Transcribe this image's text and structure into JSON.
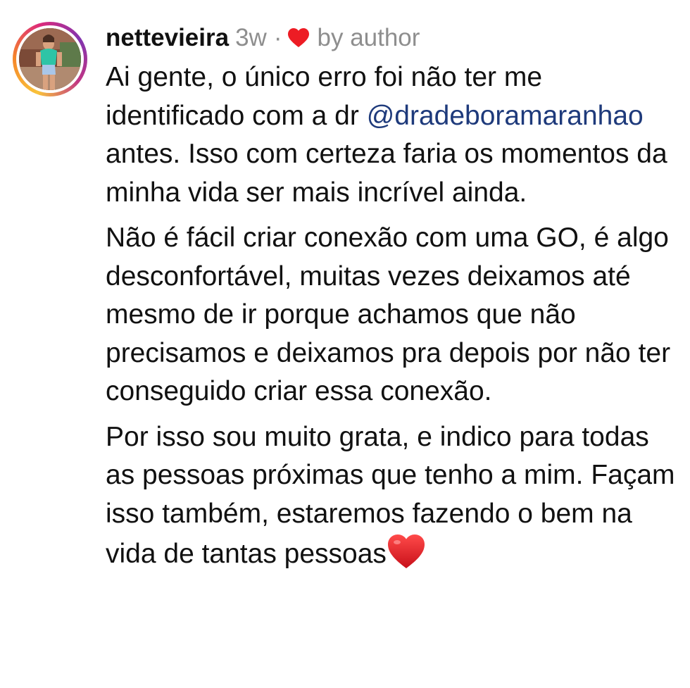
{
  "comment": {
    "username": "nettevieira",
    "time": "3w",
    "separator": "·",
    "liked_by": "by author",
    "heart_color": "#ed1c24",
    "avatar": "profile-photo",
    "paragraphs": [
      {
        "before": "Ai gente, o único erro foi não ter me identificado com a dr ",
        "mention": "@dradeboramaranhao",
        "after": " antes. Isso com certeza faria os momentos da minha vida ser mais incrível ainda."
      },
      {
        "text": "Não é fácil criar conexão com uma GO, é algo desconfortável, muitas vezes deixamos até mesmo de ir porque achamos que não precisamos e deixamos pra depois por não ter conseguido criar essa conexão."
      },
      {
        "text": "Por isso sou muito grata, e indico para todas as pessoas próximas que tenho a mim. Façam isso também, estaremos fazendo o bem na vida de tantas pessoas",
        "emoji": "red-heart-icon"
      }
    ]
  }
}
